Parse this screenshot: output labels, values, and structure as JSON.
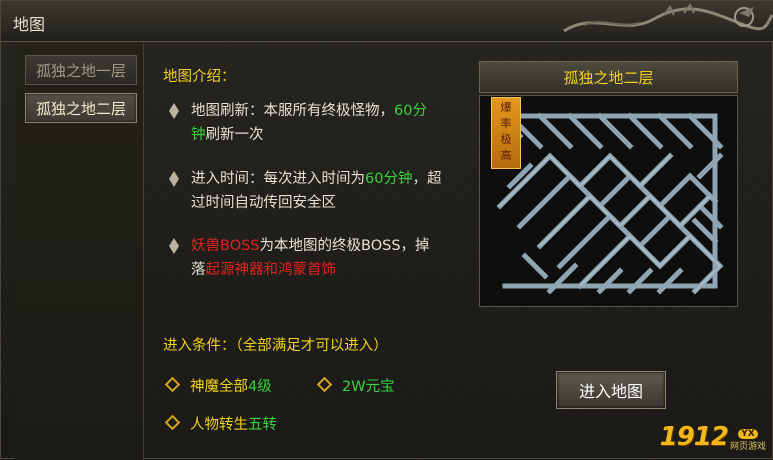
{
  "window": {
    "title": "地图"
  },
  "tabs": [
    {
      "label": "孤独之地一层"
    },
    {
      "label": "孤独之地二层"
    }
  ],
  "intro": {
    "title": "地图介绍：",
    "refresh": {
      "a": "地图刷新：本服所有终极怪物，",
      "b": "60分",
      "c": "钟",
      "d": "刷新一次"
    },
    "enter_time": {
      "a": "进入时间：每次进入时间为",
      "b": "60分钟",
      "c": "，超",
      "d": "过时间自动传回安全区"
    },
    "boss": {
      "a": "妖兽BOSS",
      "b": "为本地图的终极BOSS，掉",
      "c": "落",
      "d": "起源神器和鸿蒙首饰"
    }
  },
  "conditions": {
    "title": "进入条件：（全部满足才可以进入）",
    "c1": {
      "a": "神魔全部",
      "b": "4级"
    },
    "c2": {
      "a": "2W元宝"
    },
    "c3": {
      "a": "人物转生",
      "b": "五转"
    }
  },
  "map": {
    "name": "孤独之地二层",
    "tag": [
      "爆",
      "率",
      "极",
      "高"
    ],
    "enter_label": "进入地图"
  },
  "logo": {
    "number": "1912",
    "badge": "YX",
    "sub": "网页游戏"
  },
  "colors": {
    "yellow": "#f3d21a",
    "green": "#36d43b",
    "red": "#e52121"
  }
}
